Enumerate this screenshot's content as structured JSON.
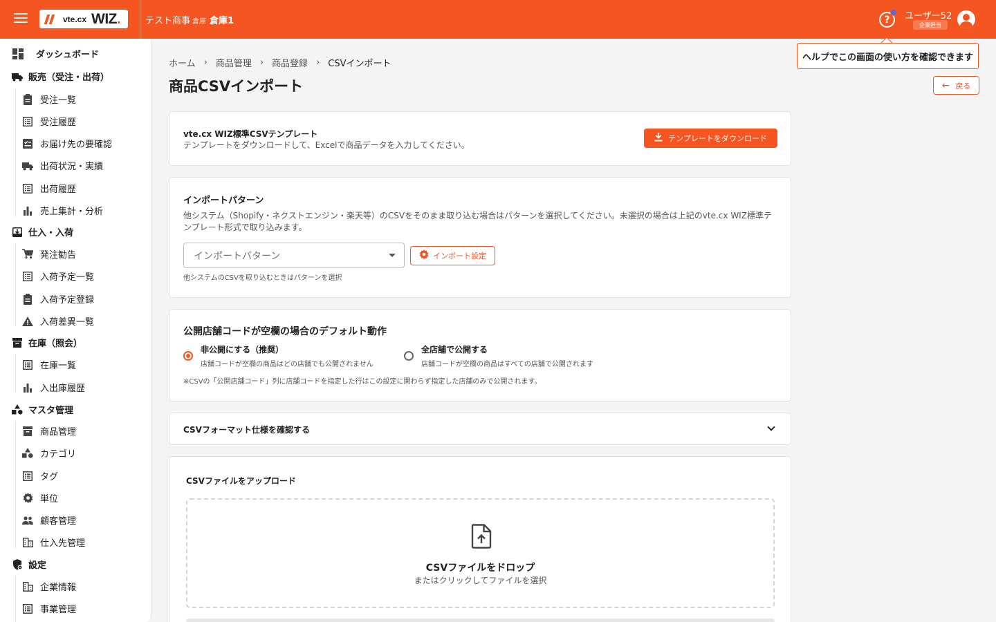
{
  "header": {
    "brand_small": "vte.cx",
    "brand_big": "WIZ",
    "brand_dot": ".",
    "company": "テスト商事",
    "warehouse_label": "倉庫",
    "warehouse_name": "倉庫1",
    "help_symbol": "?",
    "user_name": "ユーザー52",
    "user_role": "企業担当"
  },
  "tooltip": {
    "text": "ヘルプでこの画面の使い方を確認できます"
  },
  "sidebar": {
    "dashboard": "ダッシュボード",
    "sales": {
      "title": "販売（受注・出荷）",
      "items": [
        "受注一覧",
        "受注履歴",
        "お届け先の要確認",
        "出荷状況・実績",
        "出荷履歴",
        "売上集計・分析"
      ]
    },
    "purchase": {
      "title": "仕入・入荷",
      "items": [
        "発注勧告",
        "入荷予定一覧",
        "入荷予定登録",
        "入荷差異一覧"
      ]
    },
    "stock": {
      "title": "在庫（照会）",
      "items": [
        "在庫一覧",
        "入出庫履歴"
      ]
    },
    "master": {
      "title": "マスタ管理",
      "items": [
        "商品管理",
        "カテゴリ",
        "タグ",
        "単位",
        "顧客管理",
        "仕入先管理"
      ]
    },
    "settings": {
      "title": "設定",
      "items": [
        "企業情報",
        "事業管理"
      ]
    }
  },
  "breadcrumb": [
    "ホーム",
    "商品管理",
    "商品登録",
    "CSVインポート"
  ],
  "breadcrumb_sep": "›",
  "page_title": "商品CSVインポート",
  "back_button": "戻る",
  "template_card": {
    "title": "vte.cx WIZ標準CSVテンプレート",
    "desc": "テンプレートをダウンロードして、Excelで商品データを入力してください。",
    "button": "テンプレートをダウンロード"
  },
  "pattern_card": {
    "title": "インポートパターン",
    "desc_line1": "他システム（Shopify・ネクストエンジン・楽天等）のCSVをそのまま取り込む場合はパターンを選択してください。未選択の場合は上記のvte.cx WIZ標準テ",
    "desc_line2": "ンプレート形式で取り込みます。",
    "select_placeholder": "インポートパターン",
    "settings_button": "インポート設定",
    "helper": "他システムのCSVを取り込むときはパターンを選択"
  },
  "default_card": {
    "title": "公開店舗コードが空欄の場合のデフォルト動作",
    "option1_label": "非公開にする（推奨）",
    "option1_desc": "店舗コードが空欄の商品はどの店舗でも公開されません",
    "option1_selected": true,
    "option2_label": "全店舗で公開する",
    "option2_desc": "店舗コードが空欄の商品はすべての店舗で公開されます",
    "option2_selected": false,
    "note": "※CSVの「公開店舗コード」列に店舗コードを指定した行はこの設定に関わらず指定した店舗のみで公開されます。"
  },
  "format_card": {
    "title": "CSVフォーマット仕様を確認する"
  },
  "upload_card": {
    "title": "CSVファイルをアップロード",
    "drop_title": "CSVファイルをドロップ",
    "drop_sub": "またはクリックしてファイルを選択"
  },
  "colors": {
    "accent": "#f55520",
    "badge_dot": "#5a6acd"
  }
}
